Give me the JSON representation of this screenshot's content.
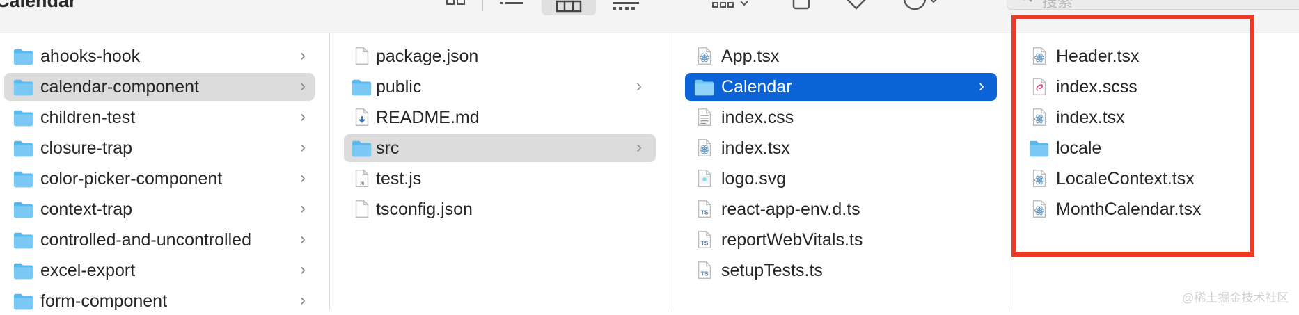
{
  "window": {
    "title": "Calendar"
  },
  "search": {
    "placeholder": "搜索"
  },
  "columns": [
    {
      "items": [
        {
          "label": "ahooks-hook",
          "kind": "folder",
          "chevron": "›"
        },
        {
          "label": "calendar-component",
          "kind": "folder",
          "chevron": "›",
          "selected": "gray"
        },
        {
          "label": "children-test",
          "kind": "folder",
          "chevron": "›"
        },
        {
          "label": "closure-trap",
          "kind": "folder",
          "chevron": "›"
        },
        {
          "label": "color-picker-component",
          "kind": "folder",
          "chevron": "›"
        },
        {
          "label": "context-trap",
          "kind": "folder",
          "chevron": "›"
        },
        {
          "label": "controlled-and-uncontrolled",
          "kind": "folder",
          "chevron": "›"
        },
        {
          "label": "excel-export",
          "kind": "folder",
          "chevron": "›"
        },
        {
          "label": "form-component",
          "kind": "folder",
          "chevron": "›"
        }
      ]
    },
    {
      "items": [
        {
          "label": "package.json",
          "kind": "file-blank"
        },
        {
          "label": "public",
          "kind": "folder",
          "chevron": "›"
        },
        {
          "label": "README.md",
          "kind": "file-md"
        },
        {
          "label": "src",
          "kind": "folder",
          "chevron": "›",
          "selected": "gray"
        },
        {
          "label": "test.js",
          "kind": "file-js"
        },
        {
          "label": "tsconfig.json",
          "kind": "file-blank"
        }
      ]
    },
    {
      "items": [
        {
          "label": "App.tsx",
          "kind": "file-react"
        },
        {
          "label": "Calendar",
          "kind": "folder",
          "chevron": "›",
          "selected": "blue"
        },
        {
          "label": "index.css",
          "kind": "file-text"
        },
        {
          "label": "index.tsx",
          "kind": "file-react"
        },
        {
          "label": "logo.svg",
          "kind": "file-svg"
        },
        {
          "label": "react-app-env.d.ts",
          "kind": "file-ts"
        },
        {
          "label": "reportWebVitals.ts",
          "kind": "file-ts"
        },
        {
          "label": "setupTests.ts",
          "kind": "file-ts"
        }
      ]
    },
    {
      "items": [
        {
          "label": "Header.tsx",
          "kind": "file-react"
        },
        {
          "label": "index.scss",
          "kind": "file-scss"
        },
        {
          "label": "index.tsx",
          "kind": "file-react"
        },
        {
          "label": "locale",
          "kind": "folder"
        },
        {
          "label": "LocaleContext.tsx",
          "kind": "file-react"
        },
        {
          "label": "MonthCalendar.tsx",
          "kind": "file-react"
        }
      ]
    }
  ],
  "icon_badges": {
    "js": "JS",
    "ts": "TS"
  },
  "colors": {
    "selection_blue": "#0b63d6",
    "selection_gray": "#dcdcdc",
    "highlight_red": "#ec3b24",
    "folder_blue": "#58b8f0"
  },
  "watermark": "@稀土掘金技术社区"
}
